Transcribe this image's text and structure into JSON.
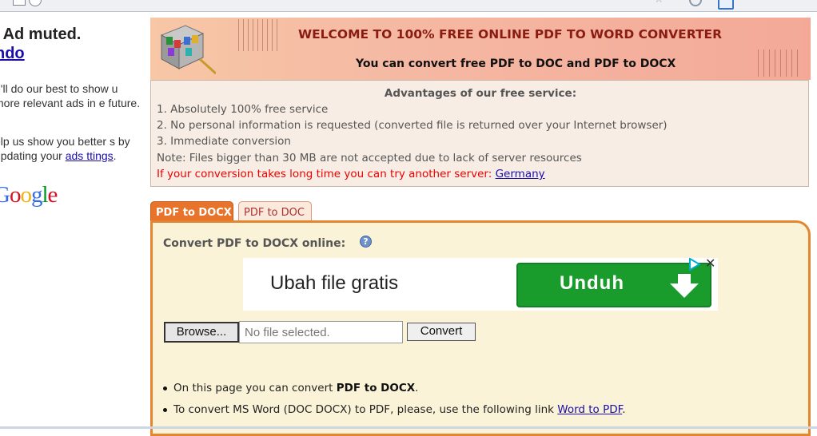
{
  "left_ad": {
    "muted": "' Ad muted.",
    "undo": "ndo",
    "message1": "e'll do our best to show u more relevant ads in e future.",
    "message2_prefix": "elp us show you better s by updating your ",
    "message2_link": "ads ttings",
    "message2_suffix": ".",
    "logo": "Google"
  },
  "banner": {
    "title": "WELCOME TO 100% FREE ONLINE PDF TO WORD CONVERTER",
    "subtitle": "You can convert free PDF to DOC and PDF to DOCX"
  },
  "advantages": {
    "heading": "Advantages of our free service:",
    "items": [
      "1. Absolutely 100% free service",
      "2. No personal information is requested (converted file is returned over your Internet browser)",
      "3. Immediate conversion"
    ],
    "note": "Note: Files bigger than 30 MB are not accepted due to lack of server resources",
    "server_text": "If your conversion takes long time you can try another server: ",
    "server_link": "Germany"
  },
  "tabs": [
    {
      "label": "PDF to DOCX",
      "active": true
    },
    {
      "label": "PDF to DOC",
      "active": false
    }
  ],
  "converter": {
    "label": "Convert PDF to DOCX online:",
    "help_icon": "?",
    "browse_label": "Browse...",
    "file_placeholder": "No file selected.",
    "convert_label": "Convert"
  },
  "ad": {
    "text": "Ubah file gratis",
    "button": "Unduh",
    "close": "✕"
  },
  "bullets": {
    "b1_prefix": "On this page you can convert ",
    "b1_bold": "PDF to DOCX",
    "b1_suffix": ".",
    "b2_prefix": "To convert MS Word (DOC DOCX) to PDF, please, use the following link ",
    "b2_link": "Word to PDF",
    "b2_suffix": "."
  },
  "colors": {
    "accent": "#e8732b",
    "panel_bg": "#fbf3d7",
    "banner_title": "#8a1d12",
    "ad_button": "#1a9c2c",
    "link": "#1a0dab",
    "warning": "#e00000"
  }
}
